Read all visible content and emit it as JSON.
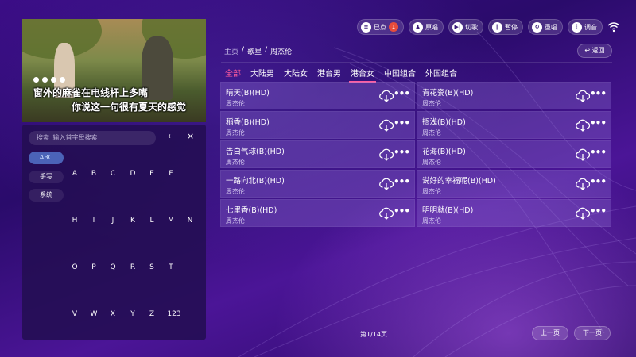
{
  "video": {
    "lyric_line1": "窗外的麻雀在电线杆上多嘴",
    "lyric_line2": "你说这一句很有夏天的感觉"
  },
  "keyboard": {
    "search_placeholder": "搜索  输入首字母搜索",
    "backspace_label": "←",
    "clear_label": "×",
    "modes": [
      "ABC",
      "手写",
      "系统"
    ],
    "rows": [
      [
        "A",
        "B",
        "C",
        "D",
        "E",
        "F"
      ],
      [
        "H",
        "I",
        "J",
        "K",
        "L",
        "M",
        "N"
      ],
      [
        "O",
        "P",
        "Q",
        "R",
        "S",
        "T"
      ],
      [
        "V",
        "W",
        "X",
        "Y",
        "Z",
        "123"
      ]
    ]
  },
  "toolbar": {
    "selected_label": "已点",
    "selected_count": "1",
    "vocal_label": "原唱",
    "next_label": "切歌",
    "pause_label": "暂停",
    "replay_label": "重唱",
    "tune_label": "调音"
  },
  "breadcrumb": {
    "home": "主页",
    "sep1": "/",
    "singer": "歌星",
    "sep2": "/",
    "artist": "周杰伦"
  },
  "return_label": "返回",
  "tabs": [
    "全部",
    "大陆男",
    "大陆女",
    "港台男",
    "港台女",
    "中国组合",
    "外国组合"
  ],
  "songs": [
    {
      "title": "晴天(B)(HD)",
      "artist": "周杰伦"
    },
    {
      "title": "青花瓷(B)(HD)",
      "artist": "周杰伦"
    },
    {
      "title": "稻香(B)(HD)",
      "artist": "周杰伦"
    },
    {
      "title": "搁浅(B)(HD)",
      "artist": "周杰伦"
    },
    {
      "title": "告白气球(B)(HD)",
      "artist": "周杰伦"
    },
    {
      "title": "花海(B)(HD)",
      "artist": "周杰伦"
    },
    {
      "title": "一路向北(B)(HD)",
      "artist": "周杰伦"
    },
    {
      "title": "说好的幸福呢(B)(HD)",
      "artist": "周杰伦"
    },
    {
      "title": "七里香(B)(HD)",
      "artist": "周杰伦"
    },
    {
      "title": "明明就(B)(HD)",
      "artist": "周杰伦"
    }
  ],
  "pager": {
    "info": "第1/14页",
    "prev_label": "上一页",
    "next_label": "下一页"
  },
  "colors": {
    "accent_pink": "#ff5c9e",
    "background": "#2a0a5e",
    "badge_red": "#e74c3c"
  }
}
